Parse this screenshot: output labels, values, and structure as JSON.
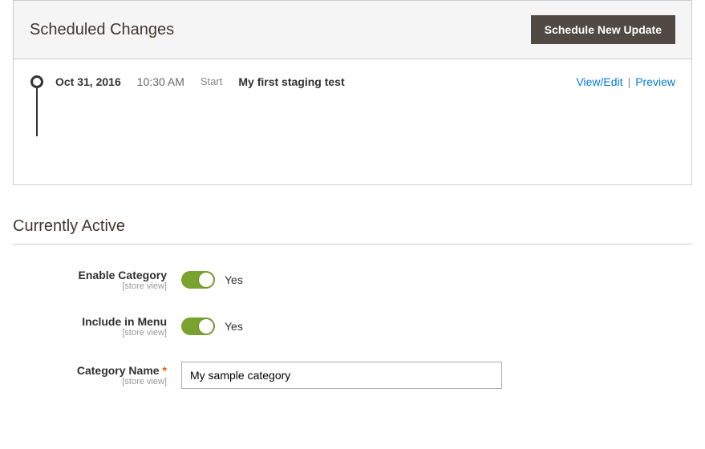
{
  "scheduled": {
    "title": "Scheduled Changes",
    "button_label": "Schedule New Update",
    "changes": [
      {
        "date": "Oct 31, 2016",
        "time": "10:30 AM",
        "type": "Start",
        "name": "My first staging test",
        "view_edit_label": "View/Edit",
        "preview_label": "Preview"
      }
    ]
  },
  "active": {
    "title": "Currently Active",
    "fields": {
      "enable_category": {
        "label": "Enable Category",
        "scope": "[store view]",
        "value_text": "Yes"
      },
      "include_in_menu": {
        "label": "Include in Menu",
        "scope": "[store view]",
        "value_text": "Yes"
      },
      "category_name": {
        "label": "Category Name",
        "scope": "[store view]",
        "value": "My sample category"
      }
    }
  }
}
